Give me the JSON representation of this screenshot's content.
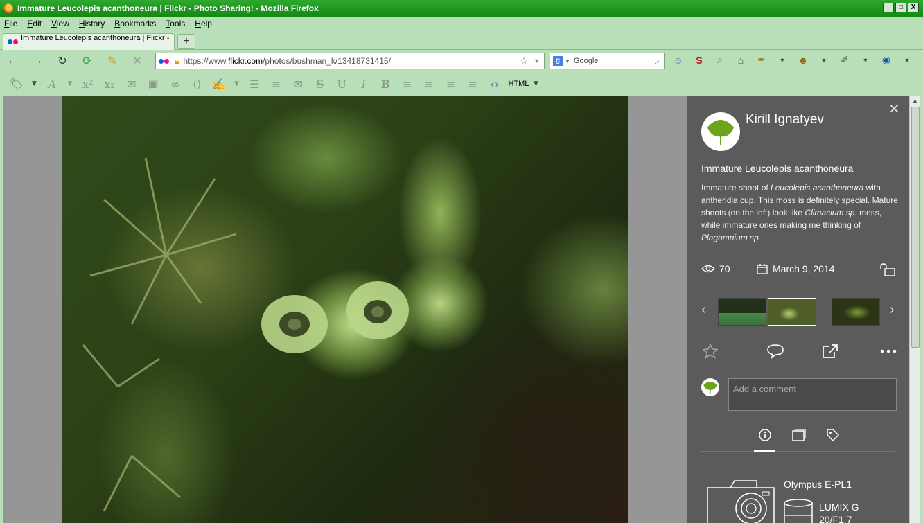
{
  "window": {
    "title": "Immature Leucolepis acanthoneura | Flickr - Photo Sharing! - Mozilla Firefox",
    "controls": [
      "_",
      "□",
      "X"
    ]
  },
  "menu": [
    "File",
    "Edit",
    "View",
    "History",
    "Bookmarks",
    "Tools",
    "Help"
  ],
  "tab": {
    "label": "Immature Leucolepis acanthoneura | Flickr - ...",
    "new_tab": "+"
  },
  "url": {
    "prefix": "https://www.",
    "domain": "flickr.com",
    "path": "/photos/bushman_k/13418731415/"
  },
  "search": {
    "placeholder": "Google"
  },
  "edit_toolbar": {
    "html_label": "HTML"
  },
  "panel": {
    "author": "Kirill Ignatyev",
    "title": "Immature Leucolepis acanthoneura",
    "desc": {
      "p1": "Immature shoot of ",
      "i1": "Leucolepis acanthoneura",
      "p2": " with antheridia cup. This moss is definitely special. Mature shoots (on the left) look like ",
      "i2": "Climacium sp.",
      "p3": " moss, while immature ones making me thinking of ",
      "i3": "Plagomnium sp."
    },
    "views": "70",
    "date": "March 9, 2014",
    "comment_placeholder": "Add a comment",
    "camera": "Olympus E-PL1",
    "lens": "LUMIX G 20/F1.7"
  },
  "colors": {
    "panel_bg": "#5b5b5b",
    "chrome_green": "#b8dfb8",
    "title_green": "#1c961c",
    "flickr_blue": "#0063dc",
    "flickr_pink": "#ff0084"
  }
}
